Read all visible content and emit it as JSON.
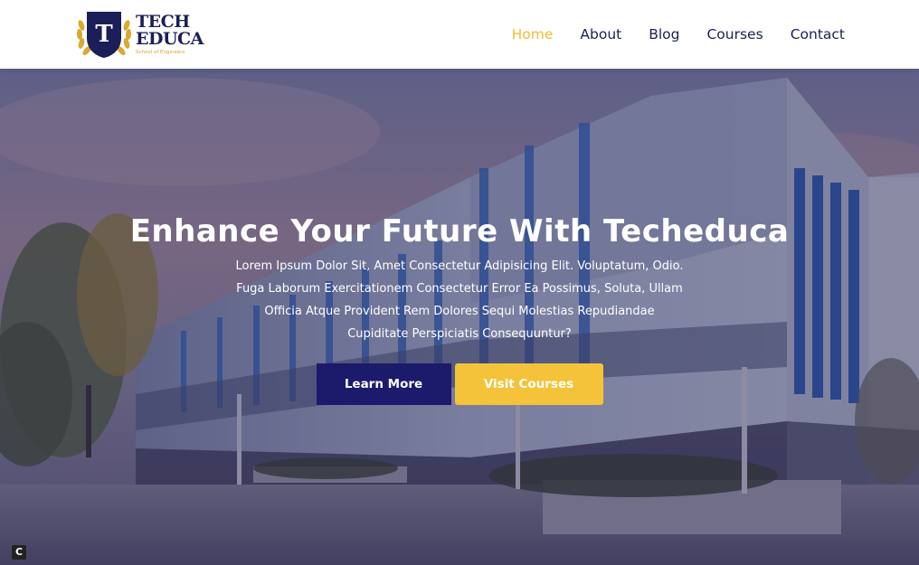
{
  "brand": {
    "logo_initial": "T",
    "name_line1": "TECH",
    "name_line2": "EDUCA",
    "tagline": "School of Engineers"
  },
  "nav": {
    "items": [
      {
        "label": "Home",
        "active": true
      },
      {
        "label": "About",
        "active": false
      },
      {
        "label": "Blog",
        "active": false
      },
      {
        "label": "Courses",
        "active": false
      },
      {
        "label": "Contact",
        "active": false
      }
    ]
  },
  "hero": {
    "title": "Enhance Your Future With Techeduca",
    "text": "Lorem Ipsum Dolor Sit, Amet Consectetur Adipisicing Elit. Voluptatum, Odio. Fuga Laborum Exercitationem Consectetur Error Ea Possimus, Soluta, Ullam Officia Atque Provident Rem Dolores Sequi Molestias Repudiandae Cupiditate Perspiciatis Consequuntur?",
    "primary_button": "Learn More",
    "secondary_button": "Visit Courses"
  },
  "corner_badge": "C",
  "colors": {
    "navy": "#1b1f57",
    "gold": "#f5bc35",
    "button_navy": "#1b1a6b",
    "button_gold": "#f5c33a"
  }
}
